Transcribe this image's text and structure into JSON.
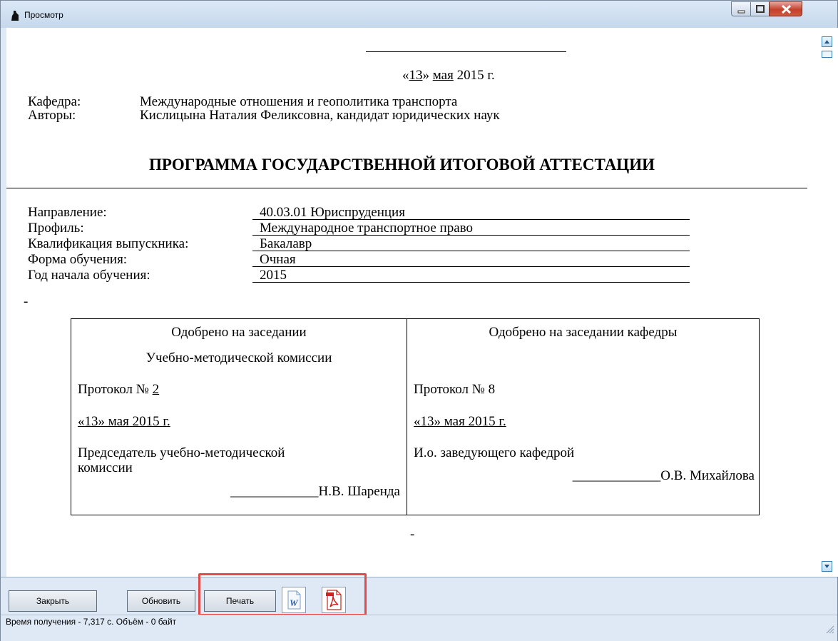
{
  "window": {
    "title": "Просмотр"
  },
  "document": {
    "date_day": "13",
    "date_month": "мая",
    "date_rest": "2015 г.",
    "department_label": "Кафедра:",
    "department_value": "Международные отношения и геополитика транспорта",
    "authors_label": "Авторы:",
    "authors_value": "Кислицына Наталия Феликсовна, кандидат юридических наук",
    "heading": "ПРОГРАММА ГОСУДАРСТВЕННОЙ ИТОГОВОЙ АТТЕСТАЦИИ",
    "fields": [
      {
        "label": "Направление:",
        "value": "40.03.01 Юриспруденция"
      },
      {
        "label": "Профиль:",
        "value": "Международное транспортное право"
      },
      {
        "label": "Квалификация выпускника:",
        "value": "Бакалавр"
      },
      {
        "label": "Форма обучения:",
        "value": "Очная"
      },
      {
        "label": "Год начала обучения:",
        "value": "2015"
      }
    ],
    "dash": "-",
    "approval_left": {
      "line1": "Одобрено на заседании",
      "line2": "Учебно-методической комиссии",
      "protocol_prefix": "Протокол № ",
      "protocol_num": "2",
      "date": "«13» мая 2015 г.",
      "role_line1": "Председатель учебно-методической",
      "role_line2": "комиссии",
      "signature": "_____________Н.В. Шаренда"
    },
    "approval_right": {
      "line1": "Одобрено на заседании кафедры",
      "protocol": "Протокол № 8",
      "date": "«13» мая 2015 г.",
      "role": "И.о. заведующего кафедрой",
      "signature": "_____________О.В. Михайлова"
    }
  },
  "toolbar": {
    "close_label": "Закрыть",
    "refresh_label": "Обновить",
    "print_label": "Печать",
    "word_icon": "word-export-icon",
    "pdf_icon": "pdf-export-icon",
    "highlight_color": "#e24a4a"
  },
  "status": {
    "text": "Время получения - 7,317 с. Объём - 0 байт"
  }
}
